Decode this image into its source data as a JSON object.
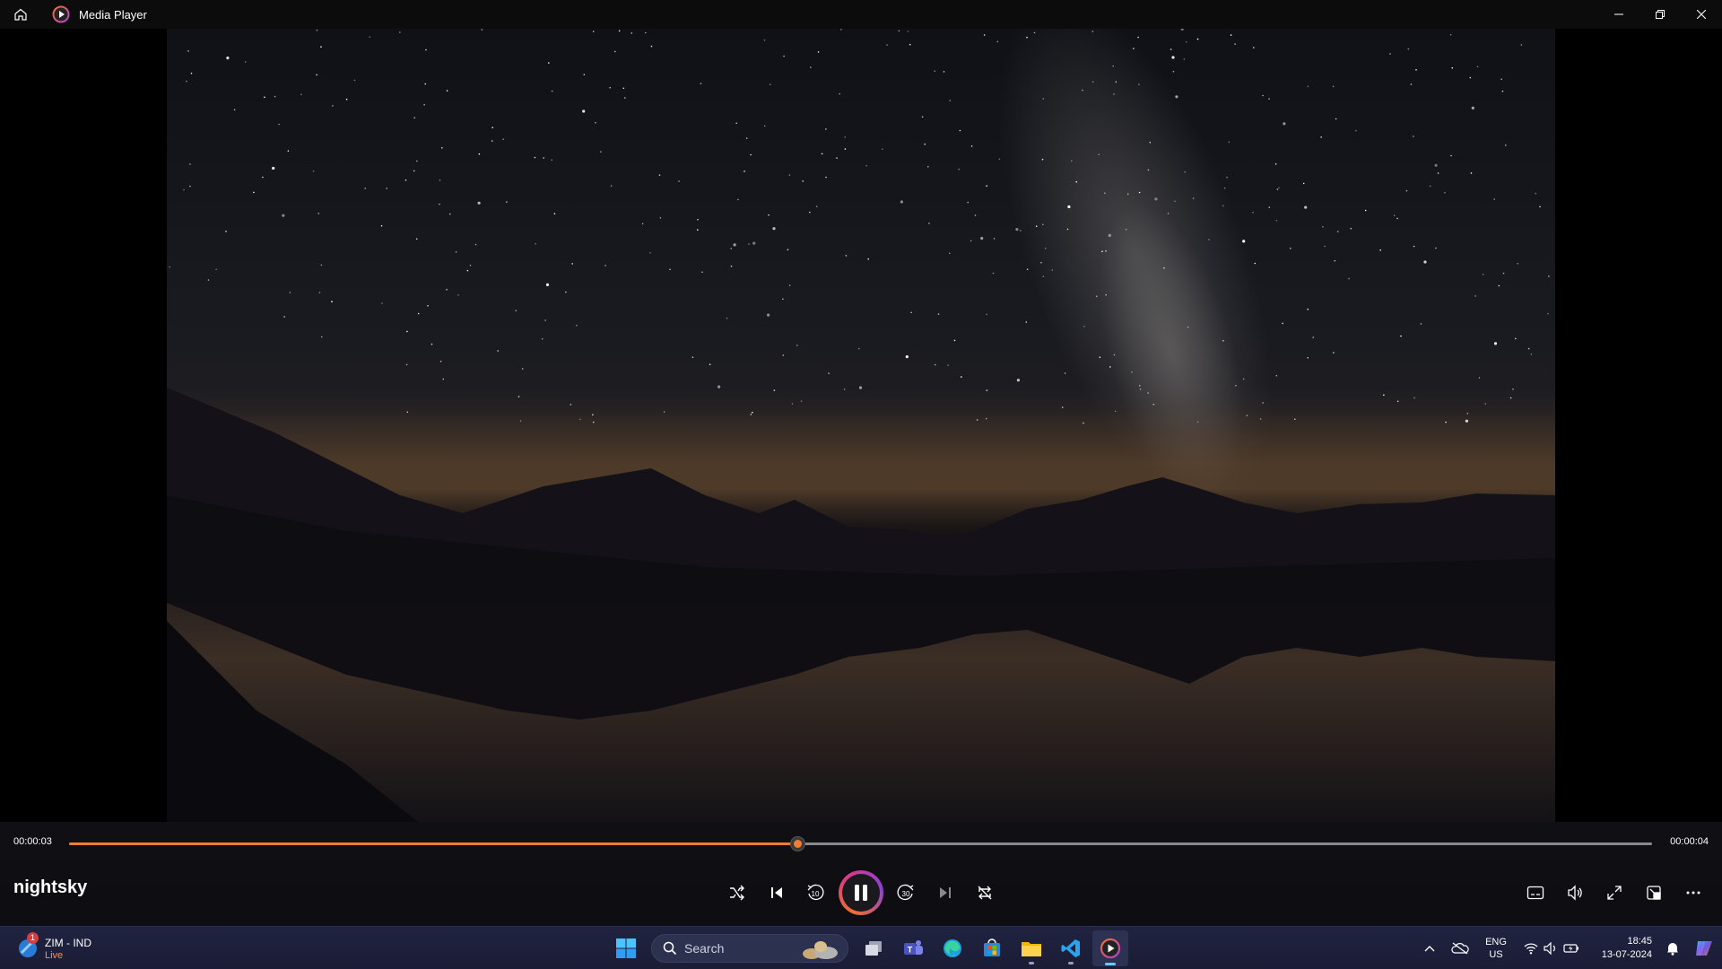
{
  "window": {
    "title": "Media Player"
  },
  "player": {
    "media_title": "nightsky",
    "current_time": "00:00:03",
    "duration": "00:00:04",
    "progress_fraction": 0.46,
    "state": "playing"
  },
  "colors": {
    "accent": "#f07d32",
    "taskbar": "#1c1f3a"
  },
  "controls": {
    "center": [
      "shuffle-icon",
      "previous-icon",
      "skip-back-10-icon",
      "pause-icon",
      "skip-forward-30-icon",
      "next-icon",
      "repeat-off-icon"
    ],
    "right": [
      "captions-icon",
      "volume-icon",
      "fullscreen-icon",
      "mini-player-icon",
      "more-icon"
    ],
    "skip_back_label": "10",
    "skip_forward_label": "30"
  },
  "taskbar": {
    "weather": {
      "label": "ZIM - IND",
      "sub": "Live",
      "badge": "1"
    },
    "search_placeholder": "Search",
    "apps": [
      "windows-start-icon",
      "task-view-icon",
      "teams-icon",
      "edge-icon",
      "store-icon",
      "file-explorer-icon",
      "vscode-icon",
      "media-player-icon"
    ],
    "language": {
      "line1": "ENG",
      "line2": "US"
    },
    "clock": {
      "time": "18:45",
      "date": "13-07-2024"
    }
  }
}
